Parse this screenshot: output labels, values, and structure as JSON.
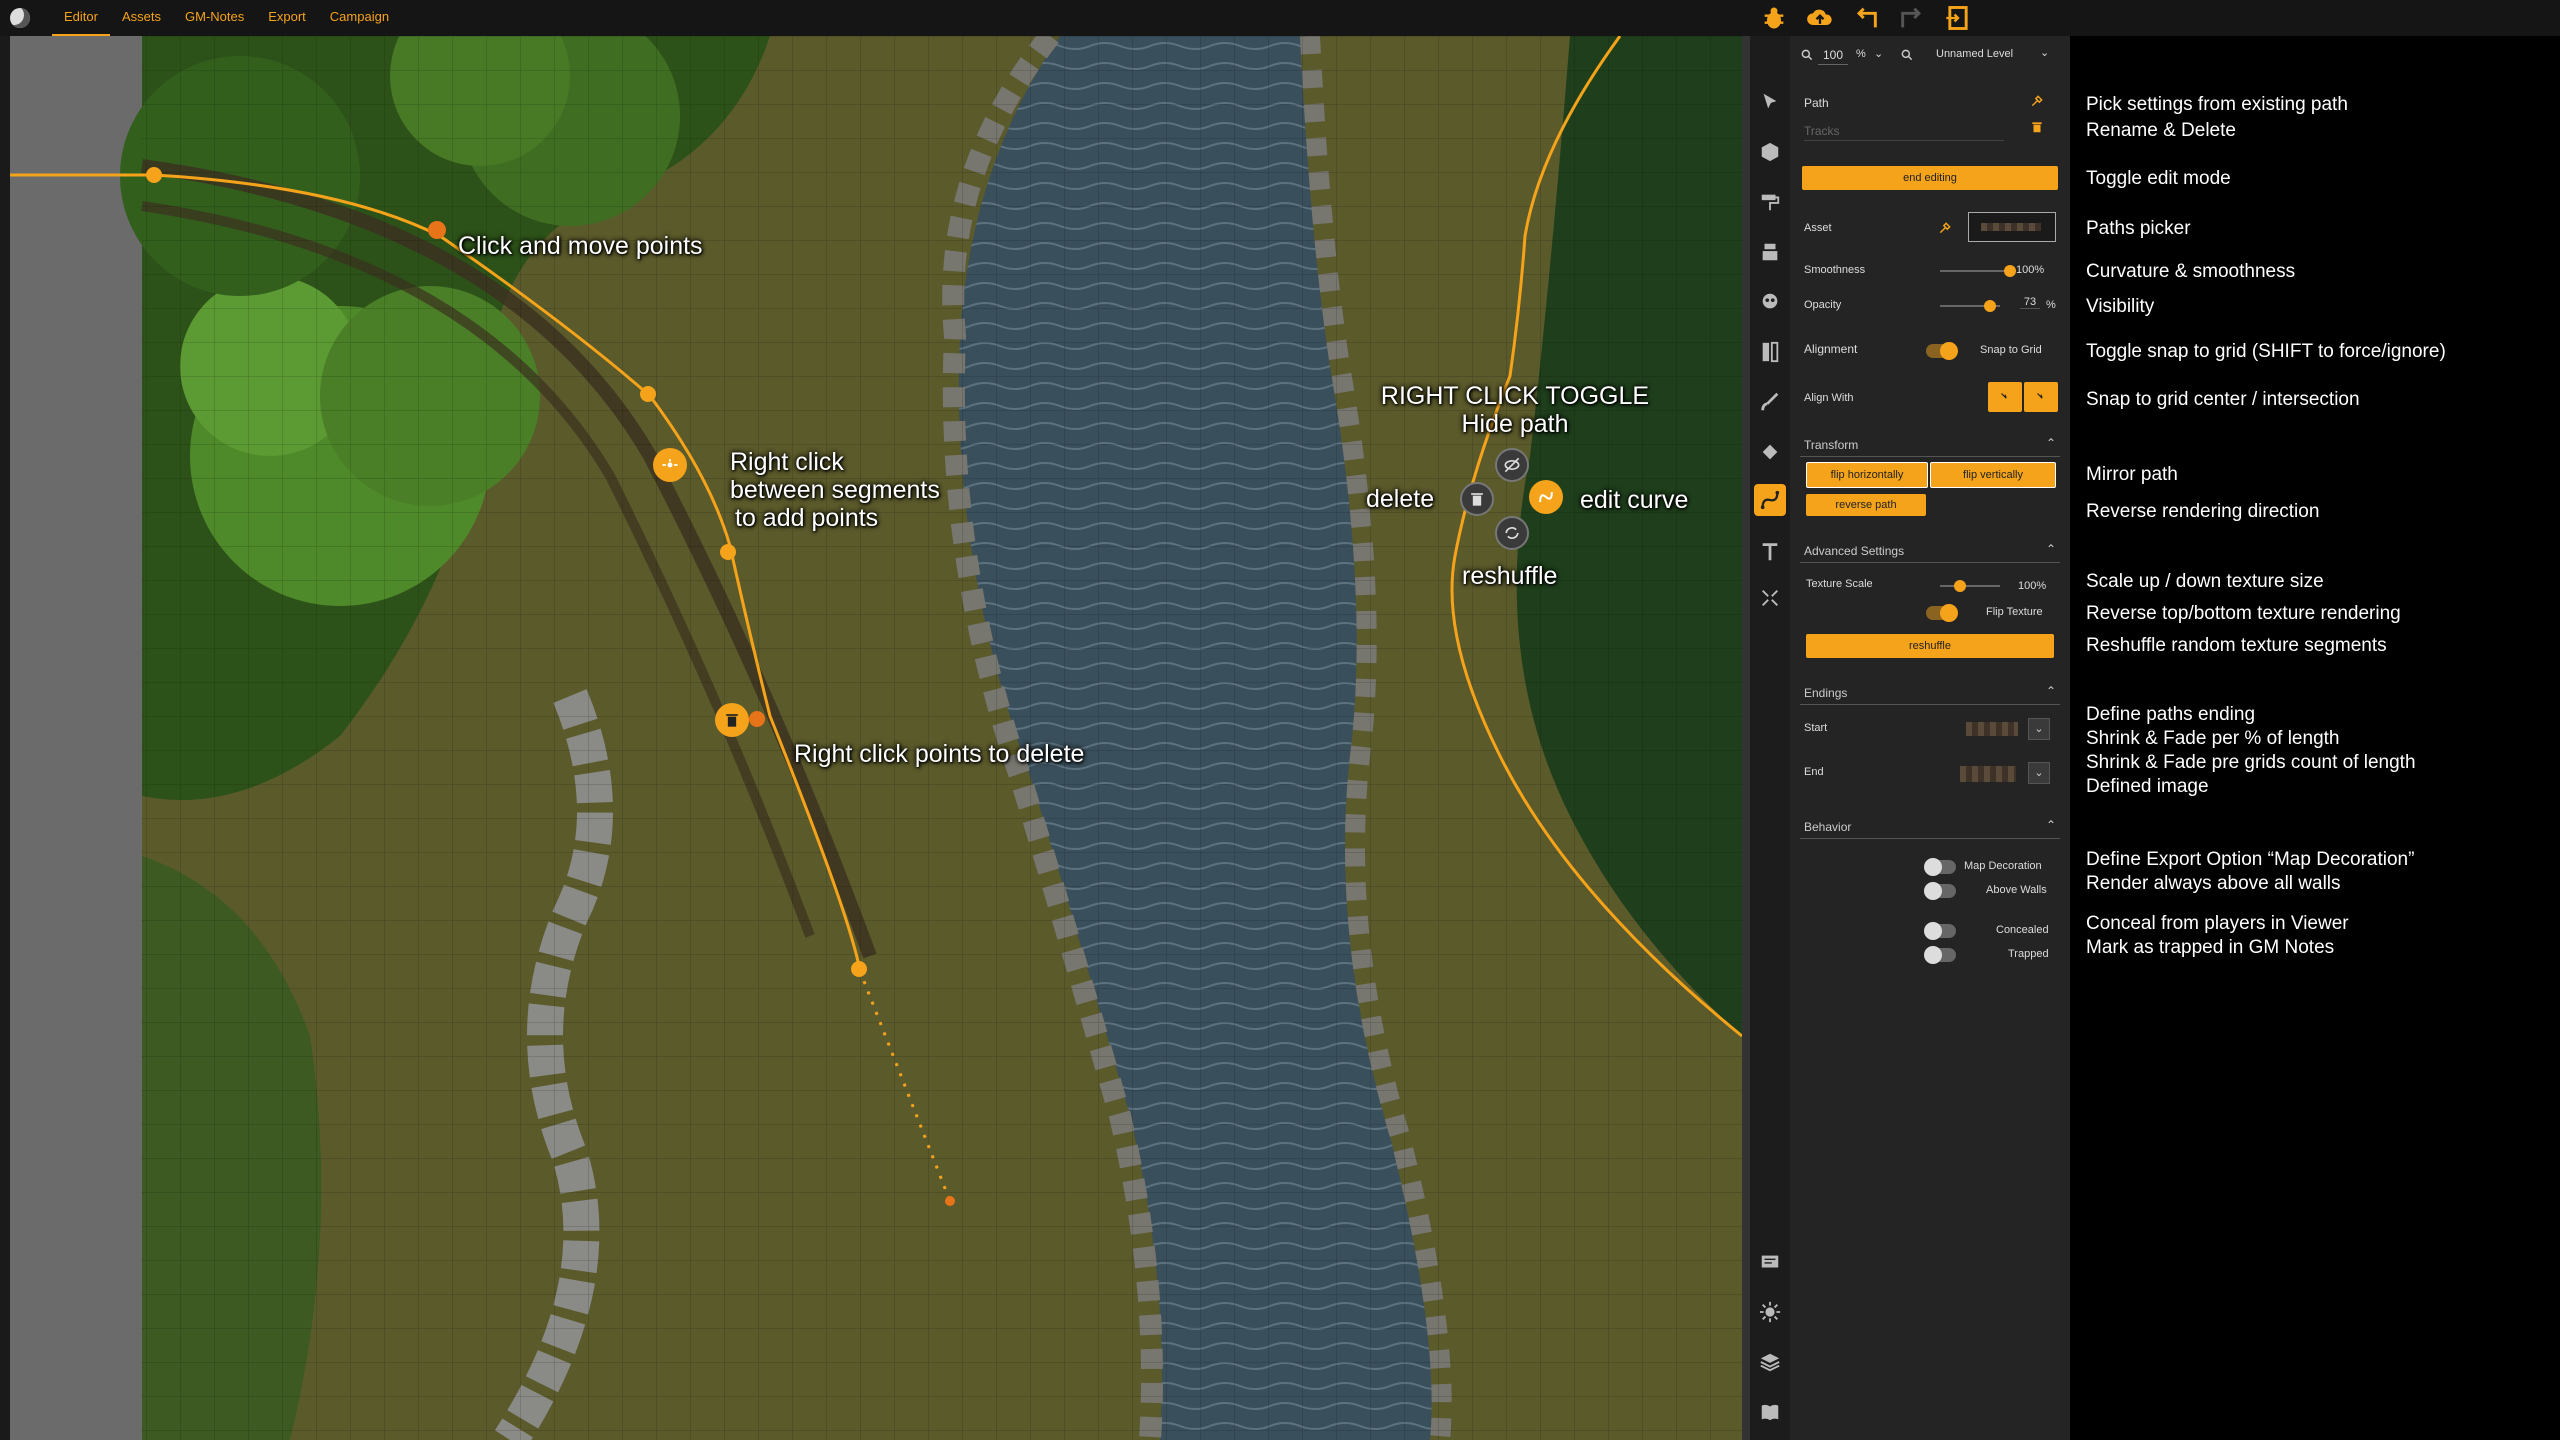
{
  "topbar": {
    "menu": [
      "Editor",
      "Assets",
      "GM-Notes",
      "Export",
      "Campaign"
    ],
    "active": "Editor"
  },
  "panel": {
    "zoom_value": "100",
    "zoom_unit": "%",
    "level_name": "Unnamed Level",
    "path_title": "Path",
    "path_name_placeholder": "Tracks",
    "end_editing": "end editing",
    "asset_label": "Asset",
    "smoothness_label": "Smoothness",
    "smoothness_value": "100%",
    "opacity_label": "Opacity",
    "opacity_value": "73",
    "opacity_unit": "%",
    "alignment_label": "Alignment",
    "snap_to_grid": "Snap to Grid",
    "align_with": "Align With",
    "transform_label": "Transform",
    "flip_horizontally": "flip horizontally",
    "flip_vertically": "flip vertically",
    "reverse_path": "reverse path",
    "advanced_label": "Advanced Settings",
    "texture_scale_label": "Texture Scale",
    "texture_scale_value": "100%",
    "flip_texture": "Flip Texture",
    "reshuffle": "reshuffle",
    "endings_label": "Endings",
    "start_label": "Start",
    "end_label": "End",
    "behavior_label": "Behavior",
    "map_decoration": "Map Decoration",
    "above_walls": "Above Walls",
    "concealed": "Concealed",
    "trapped": "Trapped"
  },
  "annotations": {
    "click_move": "Click and move points",
    "right_click_add_1": "Right click",
    "right_click_add_2": "between segments",
    "right_click_add_3": "to add points",
    "right_click_delete": "Right click points to delete",
    "toggle_title": "RIGHT CLICK TOGGLE",
    "hide_path": "Hide path",
    "delete": "delete",
    "edit_curve": "edit curve",
    "reshuffle": "reshuffle"
  },
  "help": [
    "Pick settings from existing path",
    "Rename & Delete",
    "Toggle edit mode",
    "Paths picker",
    "Curvature & smoothness",
    "Visibility",
    "Toggle snap to grid (SHIFT to force/ignore)",
    "Snap to grid center / intersection",
    "Mirror path",
    "Reverse rendering direction",
    "Scale up / down texture size",
    "Reverse top/bottom texture rendering",
    "Reshuffle random texture segments",
    "Define paths ending",
    "Shrink & Fade per % of length",
    "Shrink & Fade pre grids count of length",
    "Defined image",
    "Define Export Option “Map Decoration”",
    "Render always above all walls",
    "Conceal from players in Viewer",
    "Mark as trapped in GM Notes"
  ],
  "colors": {
    "accent": "#f5a31a",
    "panel": "#242424",
    "water": "#3a4f5c",
    "grass": "#5a5a2a",
    "forest": "#2e5a1f"
  }
}
